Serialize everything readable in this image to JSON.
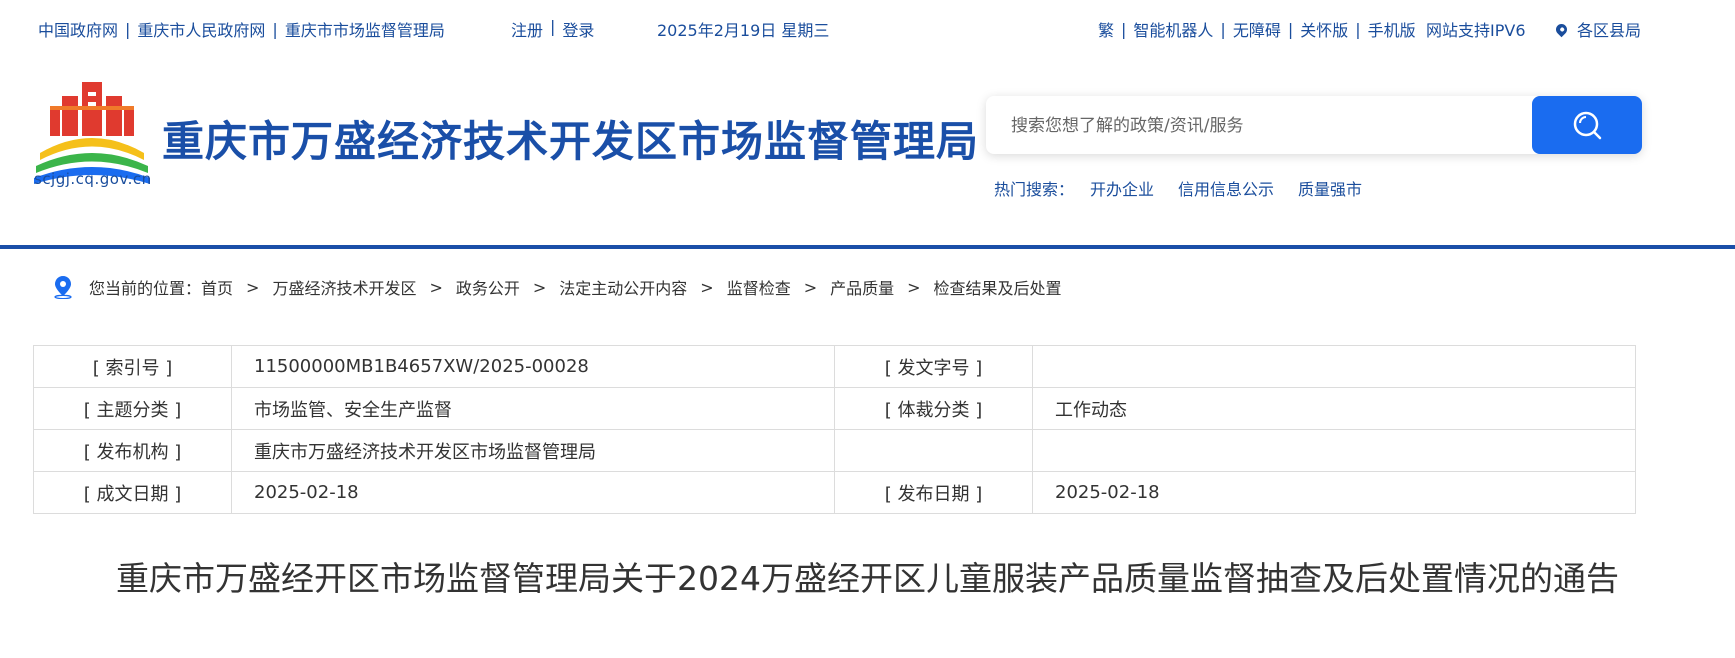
{
  "topbar": {
    "links": [
      "中国政府网",
      "重庆市人民政府网",
      "重庆市市场监督管理局"
    ],
    "register": "注册",
    "login": "登录",
    "date": "2025年2月19日 星期三",
    "right_links": [
      "繁",
      "智能机器人",
      "无障碍",
      "关怀版",
      "手机版"
    ],
    "ipv6": "网站支持IPV6",
    "region": "各区县局"
  },
  "header": {
    "logo_url": "scjgj.cq.gov.cn",
    "site_title": "重庆市万盛经济技术开发区市场监督管理局",
    "search_placeholder": "搜索您想了解的政策/资讯/服务",
    "hot_label": "热门搜索：",
    "hot_items": [
      "开办企业",
      "信用信息公示",
      "质量强市"
    ]
  },
  "breadcrumb": {
    "prefix": "您当前的位置：",
    "items": [
      "首页",
      "万盛经济技术开发区",
      "政务公开",
      "法定主动公开内容",
      "监督检查",
      "产品质量",
      "检查结果及后处置"
    ]
  },
  "meta": {
    "rows": [
      {
        "k1": "[ 索引号 ]",
        "v1": "11500000MB1B4657XW/2025-00028",
        "k2": "[ 发文字号 ]",
        "v2": ""
      },
      {
        "k1": "[ 主题分类 ]",
        "v1": "市场监管、安全生产监督",
        "k2": "[ 体裁分类 ]",
        "v2": "工作动态"
      },
      {
        "k1": "[ 发布机构 ]",
        "v1": "重庆市万盛经济技术开发区市场监督管理局",
        "k2": "",
        "v2": ""
      },
      {
        "k1": "[ 成文日期 ]",
        "v1": "2025-02-18",
        "k2": "[ 发布日期 ]",
        "v2": "2025-02-18"
      }
    ]
  },
  "article": {
    "title": "重庆市万盛经开区市场监督管理局关于2024万盛经开区儿童服装产品质量监督抽查及后处置情况的通告"
  },
  "colors": {
    "brand_blue": "#1a4fa8",
    "search_button": "#1a6cf0"
  }
}
